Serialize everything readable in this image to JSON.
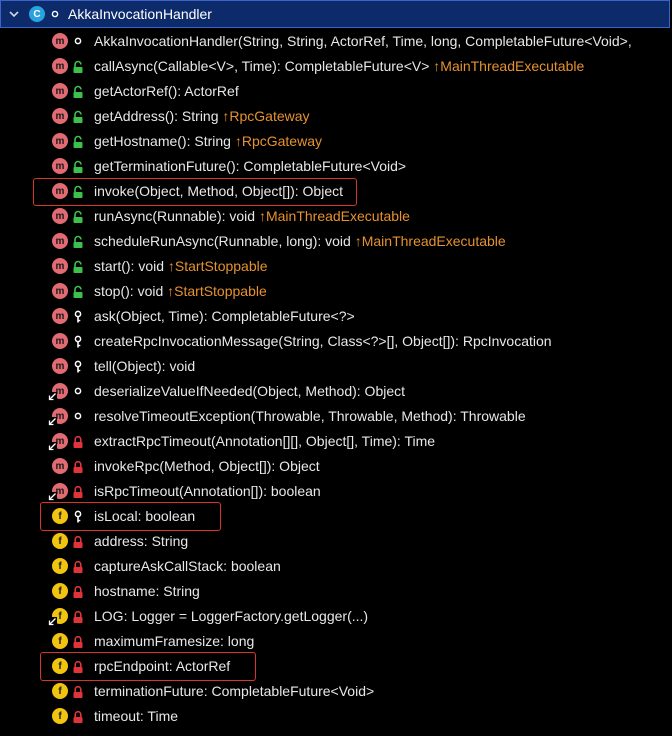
{
  "header": {
    "class_icon_letter": "C",
    "class_name": "AkkaInvocationHandler"
  },
  "members": [
    {
      "kind": "m",
      "vis": "package",
      "name": "AkkaInvocationHandler(String, String, ActorRef, Time, long, CompletableFuture<Void>,",
      "inherited": ""
    },
    {
      "kind": "m",
      "vis": "public",
      "name": "callAsync(Callable<V>, Time): CompletableFuture<V>",
      "inherited": "↑MainThreadExecutable"
    },
    {
      "kind": "m",
      "vis": "public",
      "name": "getActorRef(): ActorRef",
      "inherited": ""
    },
    {
      "kind": "m",
      "vis": "public",
      "name": "getAddress(): String",
      "inherited": "↑RpcGateway"
    },
    {
      "kind": "m",
      "vis": "public",
      "name": "getHostname(): String",
      "inherited": "↑RpcGateway"
    },
    {
      "kind": "m",
      "vis": "public",
      "name": "getTerminationFuture(): CompletableFuture<Void>",
      "inherited": ""
    },
    {
      "kind": "m",
      "vis": "public",
      "name": "invoke(Object, Method, Object[]): Object",
      "inherited": "",
      "highlight": true
    },
    {
      "kind": "m",
      "vis": "public",
      "name": "runAsync(Runnable): void",
      "inherited": "↑MainThreadExecutable"
    },
    {
      "kind": "m",
      "vis": "public",
      "name": "scheduleRunAsync(Runnable, long): void",
      "inherited": "↑MainThreadExecutable"
    },
    {
      "kind": "m",
      "vis": "public",
      "name": "start(): void",
      "inherited": "↑StartStoppable"
    },
    {
      "kind": "m",
      "vis": "public",
      "name": "stop(): void",
      "inherited": "↑StartStoppable"
    },
    {
      "kind": "m",
      "vis": "protected",
      "name": "ask(Object, Time): CompletableFuture<?>",
      "inherited": ""
    },
    {
      "kind": "m",
      "vis": "protected",
      "name": "createRpcInvocationMessage(String, Class<?>[], Object[]): RpcInvocation",
      "inherited": ""
    },
    {
      "kind": "m",
      "vis": "protected",
      "name": "tell(Object): void",
      "inherited": ""
    },
    {
      "kind": "m",
      "vis": "package",
      "name": "deserializeValueIfNeeded(Object, Method): Object",
      "inherited": "",
      "static": true
    },
    {
      "kind": "m",
      "vis": "package",
      "name": "resolveTimeoutException(Throwable, Throwable, Method): Throwable",
      "inherited": "",
      "static": true
    },
    {
      "kind": "m",
      "vis": "private",
      "name": "extractRpcTimeout(Annotation[][], Object[], Time): Time",
      "inherited": "",
      "static": true
    },
    {
      "kind": "m",
      "vis": "private",
      "name": "invokeRpc(Method, Object[]): Object",
      "inherited": ""
    },
    {
      "kind": "m",
      "vis": "private",
      "name": "isRpcTimeout(Annotation[]): boolean",
      "inherited": "",
      "static": true
    },
    {
      "kind": "f",
      "vis": "protected",
      "name": "isLocal: boolean",
      "inherited": "",
      "highlight": true
    },
    {
      "kind": "f",
      "vis": "private",
      "name": "address: String",
      "inherited": ""
    },
    {
      "kind": "f",
      "vis": "private",
      "name": "captureAskCallStack: boolean",
      "inherited": ""
    },
    {
      "kind": "f",
      "vis": "private",
      "name": "hostname: String",
      "inherited": ""
    },
    {
      "kind": "f",
      "vis": "private",
      "name": "LOG: Logger = LoggerFactory.getLogger(...)",
      "inherited": "",
      "static": true
    },
    {
      "kind": "f",
      "vis": "private",
      "name": "maximumFramesize: long",
      "inherited": ""
    },
    {
      "kind": "f",
      "vis": "private",
      "name": "rpcEndpoint: ActorRef",
      "inherited": "",
      "highlight": true
    },
    {
      "kind": "f",
      "vis": "private",
      "name": "terminationFuture: CompletableFuture<Void>",
      "inherited": ""
    },
    {
      "kind": "f",
      "vis": "private",
      "name": "timeout: Time",
      "inherited": ""
    }
  ],
  "colors": {
    "method": "#e26b73",
    "field": "#f1c40f",
    "public": "#3cc24b",
    "private": "#e0343a",
    "inherited": "#e6922e",
    "highlight": "#d8342a",
    "header_bg": "#0d2a6b"
  }
}
